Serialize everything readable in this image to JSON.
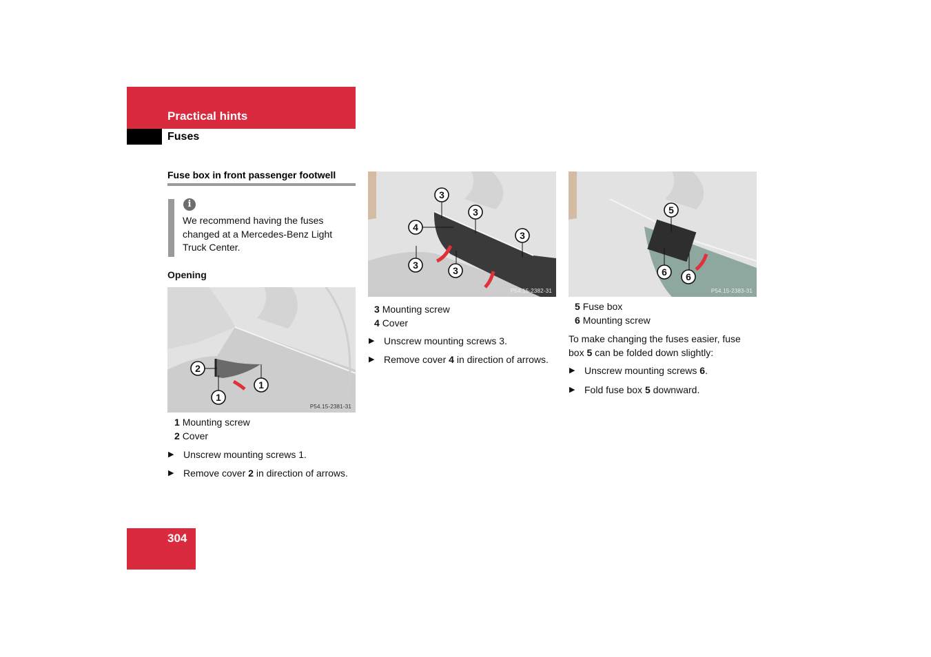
{
  "header": {
    "chapter": "Practical hints",
    "section": "Fuses"
  },
  "section_title": "Fuse box in front passenger footwell",
  "note": {
    "icon": "info-icon",
    "icon_glyph": "i",
    "text": "We recommend having the fuses changed at a Mercedes-Benz Light Truck Center."
  },
  "opening_heading": "Opening",
  "figures": [
    {
      "code": "P54.15-2381-31",
      "callouts": [
        "2",
        "1",
        "1"
      ],
      "legend": [
        {
          "num": "1",
          "label": "Mounting screw"
        },
        {
          "num": "2",
          "label": "Cover"
        }
      ],
      "steps": [
        {
          "pre": "Unscrew mounting screws 1.",
          "bold": "",
          "post": ""
        },
        {
          "pre": "Remove cover ",
          "bold": "2",
          "post": " in direction of arrows."
        }
      ]
    },
    {
      "code": "P54.15-2382-31",
      "callouts": [
        "3",
        "3",
        "4",
        "3",
        "3",
        "3"
      ],
      "legend": [
        {
          "num": "3",
          "label": "Mounting screw"
        },
        {
          "num": "4",
          "label": "Cover"
        }
      ],
      "steps": [
        {
          "pre": "Unscrew mounting screws 3.",
          "bold": "",
          "post": ""
        },
        {
          "pre": "Remove cover ",
          "bold": "4",
          "post": " in direction of arrows."
        }
      ]
    },
    {
      "code": "P54.15-2383-31",
      "callouts": [
        "5",
        "6",
        "6"
      ],
      "legend": [
        {
          "num": "5",
          "label": "Fuse box"
        },
        {
          "num": "6",
          "label": "Mounting screw"
        }
      ],
      "paragraph": {
        "line1": "To make changing the fuses easier, fuse",
        "line2_pre": "box ",
        "line2_bold": "5",
        "line2_post": " can be folded down slightly:"
      },
      "steps": [
        {
          "pre": "Unscrew mounting screws ",
          "bold": "6",
          "post": "."
        },
        {
          "pre": "Fold fuse box ",
          "bold": "5",
          "post": " downward."
        }
      ]
    }
  ],
  "bullet_glyph": "▶",
  "page_number": "304",
  "colors": {
    "brand_red": "#da2a3e",
    "rule_gray": "#9a9a9a",
    "arrow_red": "#e0303a",
    "panel_dark": "#3a3a3a"
  }
}
